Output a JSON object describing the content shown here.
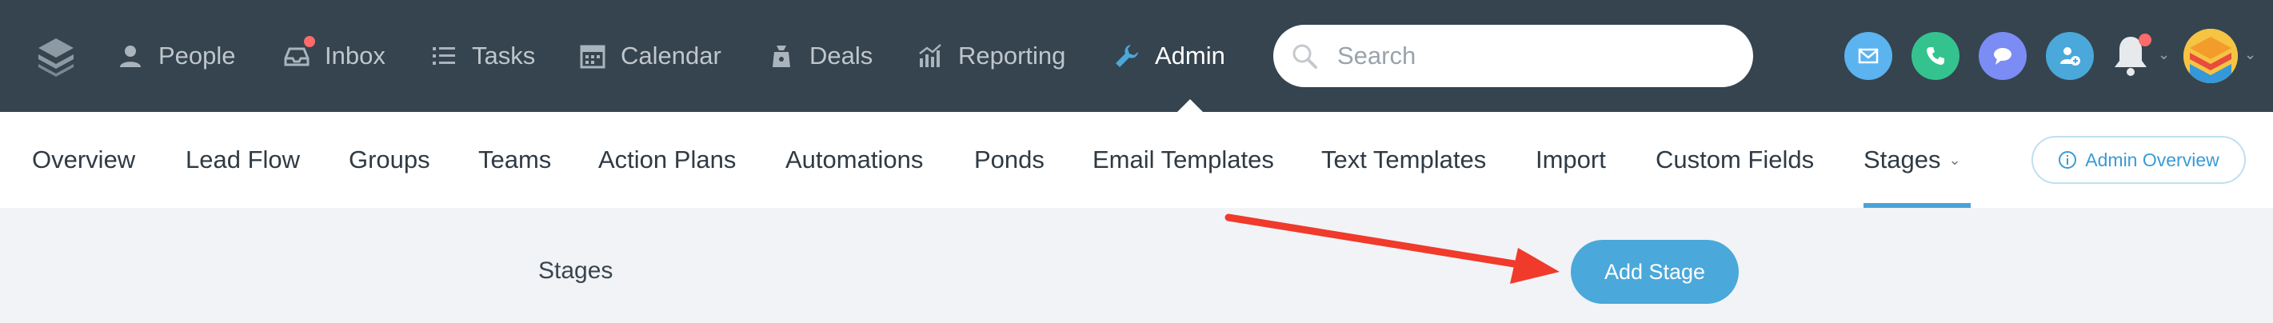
{
  "topnav": {
    "items": [
      {
        "label": "People",
        "icon": "person-icon"
      },
      {
        "label": "Inbox",
        "icon": "inbox-icon"
      },
      {
        "label": "Tasks",
        "icon": "list-icon"
      },
      {
        "label": "Calendar",
        "icon": "calendar-icon"
      },
      {
        "label": "Deals",
        "icon": "bag-icon"
      },
      {
        "label": "Reporting",
        "icon": "chart-icon"
      },
      {
        "label": "Admin",
        "icon": "wrench-icon",
        "active": true
      }
    ],
    "search_placeholder": "Search"
  },
  "subnav": {
    "items": [
      "Overview",
      "Lead Flow",
      "Groups",
      "Teams",
      "Action Plans",
      "Automations",
      "Ponds",
      "Email Templates",
      "Text Templates",
      "Import",
      "Custom Fields",
      "Stages"
    ],
    "active": "Stages",
    "admin_overview_label": "Admin Overview"
  },
  "content": {
    "title": "Stages",
    "add_button_label": "Add Stage"
  },
  "colors": {
    "topbar": "#35444f",
    "accent": "#4aa8db",
    "annotation_arrow": "#f03a2b",
    "email": "#5bb3f0",
    "phone": "#34c38f",
    "chat": "#7b8cf5",
    "contact": "#4aa8db"
  }
}
